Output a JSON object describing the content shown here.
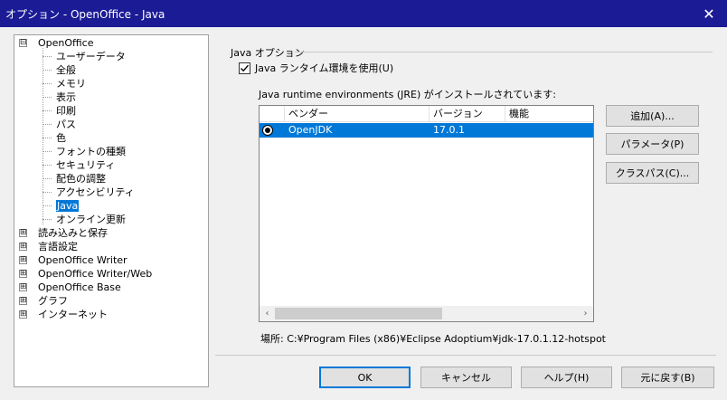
{
  "window": {
    "title": "オプション - OpenOffice - Java",
    "close_glyph": "✕"
  },
  "tree": {
    "items": [
      {
        "label": "OpenOffice",
        "level": 0,
        "expander": "⊟"
      },
      {
        "label": "ユーザーデータ",
        "level": 1
      },
      {
        "label": "全般",
        "level": 1
      },
      {
        "label": "メモリ",
        "level": 1
      },
      {
        "label": "表示",
        "level": 1
      },
      {
        "label": "印刷",
        "level": 1
      },
      {
        "label": "パス",
        "level": 1
      },
      {
        "label": "色",
        "level": 1
      },
      {
        "label": "フォントの種類",
        "level": 1
      },
      {
        "label": "セキュリティ",
        "level": 1
      },
      {
        "label": "配色の調整",
        "level": 1
      },
      {
        "label": "アクセシビリティ",
        "level": 1
      },
      {
        "label": "Java",
        "level": 1,
        "selected": true
      },
      {
        "label": "オンライン更新",
        "level": 1
      },
      {
        "label": "読み込みと保存",
        "level": 0,
        "expander": "⊞"
      },
      {
        "label": "言語設定",
        "level": 0,
        "expander": "⊞"
      },
      {
        "label": "OpenOffice Writer",
        "level": 0,
        "expander": "⊞"
      },
      {
        "label": "OpenOffice Writer/Web",
        "level": 0,
        "expander": "⊞"
      },
      {
        "label": "OpenOffice Base",
        "level": 0,
        "expander": "⊞"
      },
      {
        "label": "グラフ",
        "level": 0,
        "expander": "⊞"
      },
      {
        "label": "インターネット",
        "level": 0,
        "expander": "⊞"
      }
    ]
  },
  "java": {
    "group_label": "Java オプション",
    "use_jre_label": "Java ランタイム環境を使用(U)",
    "use_jre_checked": true,
    "list_label": "Java runtime environments (JRE) がインストールされています:",
    "columns": [
      "ベンダー",
      "バージョン",
      "機能"
    ],
    "rows": [
      {
        "vendor": "OpenJDK",
        "version": "17.0.1",
        "features": "",
        "selected": true
      }
    ],
    "location": "場所: C:¥Program Files (x86)¥Eclipse Adoptium¥jdk-17.0.1.12-hotspot",
    "buttons": {
      "add": "追加(A)...",
      "parameters": "パラメータ(P)",
      "classpath": "クラスパス(C)..."
    }
  },
  "footer": {
    "ok": "OK",
    "cancel": "キャンセル",
    "help": "ヘルプ(H)",
    "reset": "元に戻す(B)"
  },
  "scrollbar": {
    "left_glyph": "‹",
    "right_glyph": "›"
  },
  "colors": {
    "titlebar": "#1b1b96",
    "selection": "#0078d7"
  }
}
